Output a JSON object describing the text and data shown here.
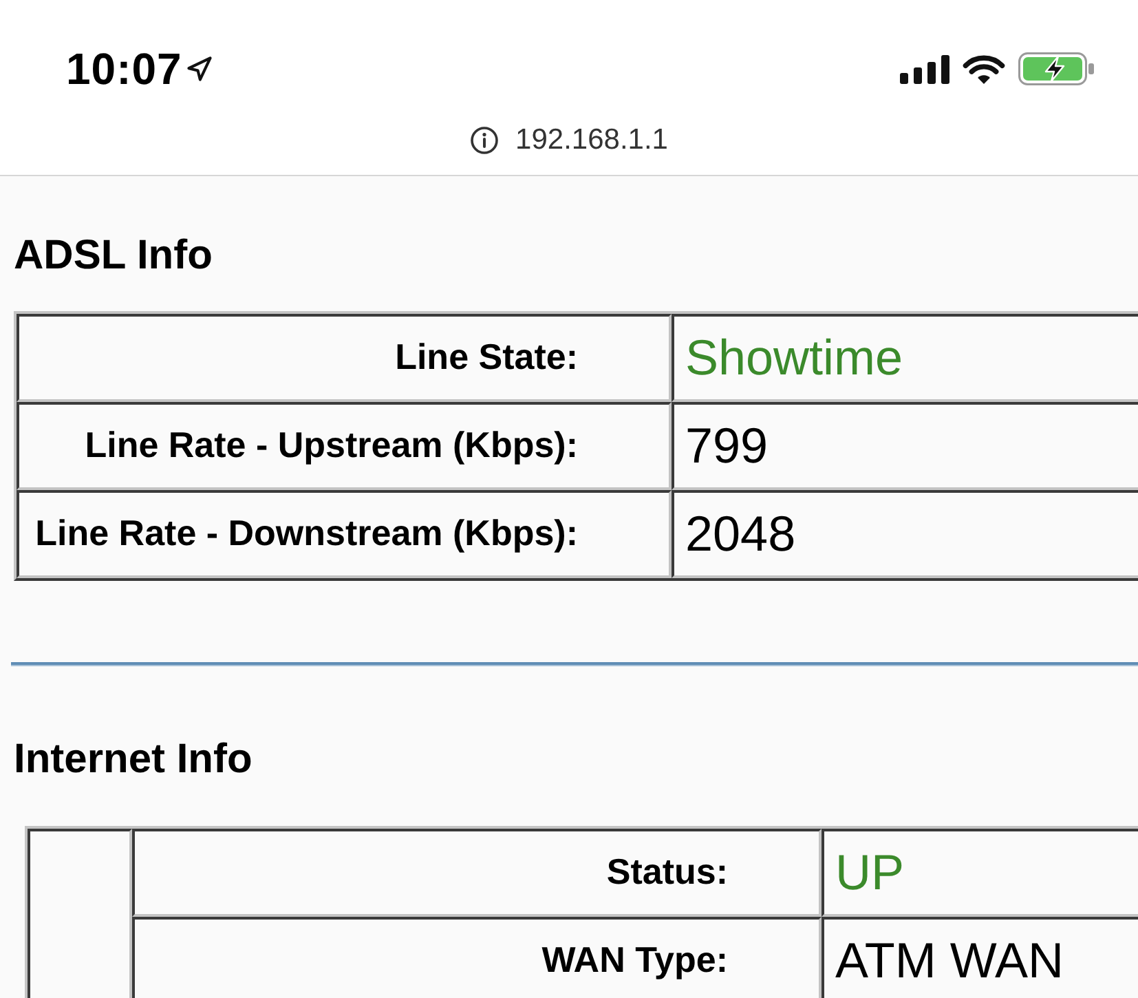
{
  "status_bar": {
    "time": "10:07"
  },
  "address_bar": {
    "url": "192.168.1.1"
  },
  "sections": [
    {
      "title": "ADSL Info",
      "kind": "plain",
      "rows": [
        {
          "label": "Line State:",
          "value": "Showtime",
          "color": "#3b8a2b"
        },
        {
          "label": "Line Rate - Upstream (Kbps):",
          "value": "799",
          "color": "#000000"
        },
        {
          "label": "Line Rate - Downstream (Kbps):",
          "value": "2048",
          "color": "#000000"
        }
      ]
    },
    {
      "title": "Internet Info",
      "kind": "nested",
      "rows": [
        {
          "label": "Status:",
          "value": "UP",
          "color": "#3b8a2b"
        },
        {
          "label": "WAN Type:",
          "value": "ATM WAN",
          "color": "#000000"
        }
      ]
    }
  ]
}
